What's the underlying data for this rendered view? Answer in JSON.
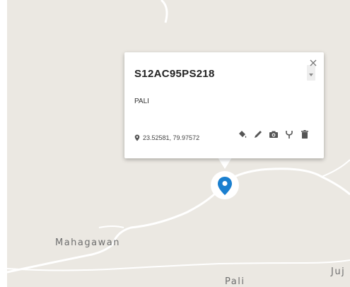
{
  "map": {
    "labels": {
      "mahagawan": "Mahagawan",
      "pali": "Pali",
      "juj": "Juj"
    },
    "colors": {
      "land": "#ebe8e2",
      "road": "#ffffff",
      "marker": "#1a7fcf"
    }
  },
  "popup": {
    "title": "S12AC95PS218",
    "description": "PALI",
    "coordinates": "23.52581, 79.97572",
    "icons": [
      "map-pin-icon",
      "close-icon",
      "scroll-down-icon",
      "paint-bucket-icon",
      "pencil-icon",
      "camera-icon",
      "fork-icon",
      "trash-icon"
    ]
  }
}
